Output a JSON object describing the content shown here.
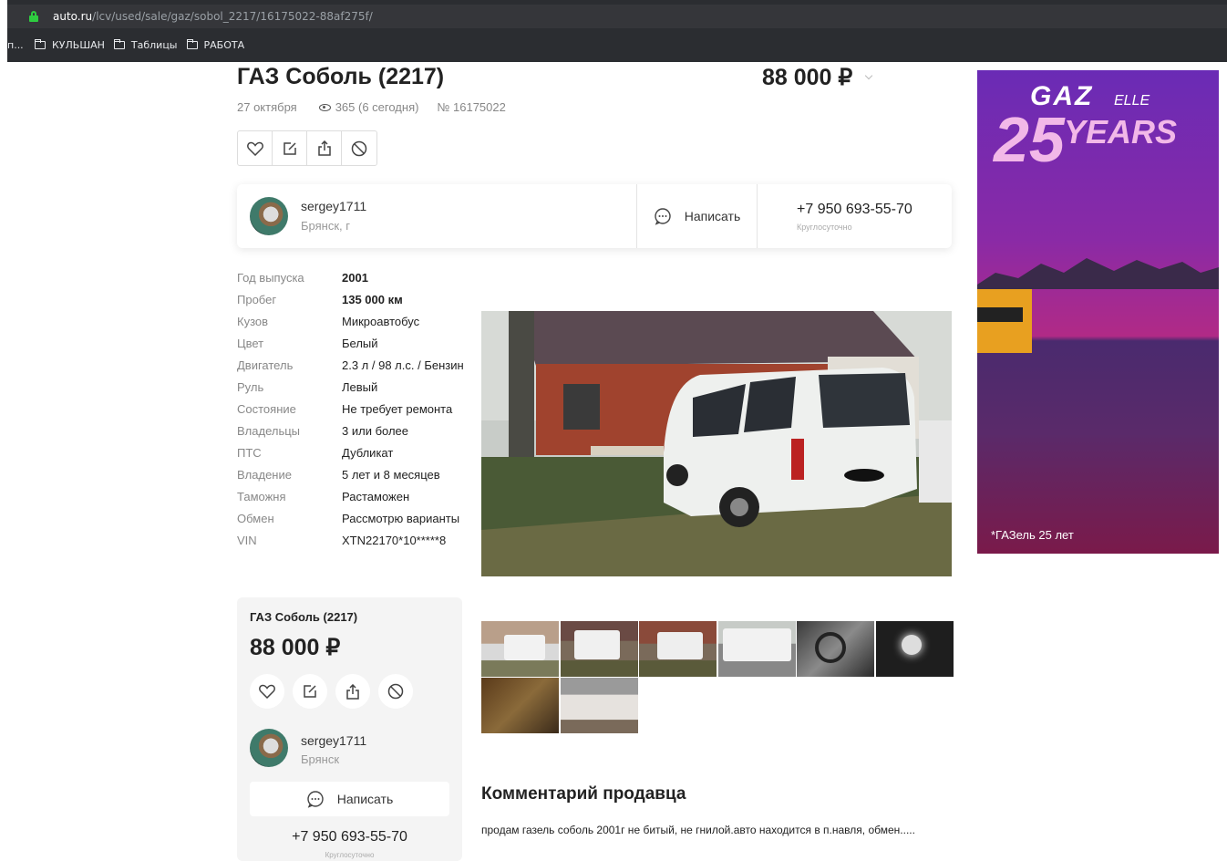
{
  "browser": {
    "url_host": "auto.ru",
    "url_path": "/lcv/used/sale/gaz/sobol_2217/16175022-88af275f/",
    "bookmark_cut": "п...",
    "bookmarks": [
      "КУЛЬШАН",
      "Таблицы",
      "РАБОТА"
    ]
  },
  "listing": {
    "title": "ГАЗ Соболь (2217)",
    "price": "88 000 ₽",
    "date": "27 октября",
    "views": "365 (6 сегодня)",
    "number": "№ 16175022"
  },
  "seller": {
    "name": "sergey1711",
    "city": "Брянск, г",
    "city_short": "Брянск",
    "write_label": "Написать",
    "phone": "+7 950 693-55-70",
    "phone_note": "Круглосуточно"
  },
  "specs": [
    {
      "k": "Год выпуска",
      "v": "2001",
      "bold": true
    },
    {
      "k": "Пробег",
      "v": "135 000 км",
      "bold": true
    },
    {
      "k": "Кузов",
      "v": "Микроавтобус"
    },
    {
      "k": "Цвет",
      "v": "Белый"
    },
    {
      "k": "Двигатель",
      "v": "2.3 л / 98 л.с. / Бензин"
    },
    {
      "k": "Руль",
      "v": "Левый"
    },
    {
      "k": "Состояние",
      "v": "Не требует ремонта"
    },
    {
      "k": "Владельцы",
      "v": "3 или более"
    },
    {
      "k": "ПТС",
      "v": "Дубликат"
    },
    {
      "k": "Владение",
      "v": "5 лет и 8 месяцев"
    },
    {
      "k": "Таможня",
      "v": "Растаможен"
    },
    {
      "k": "Обмен",
      "v": "Рассмотрю варианты"
    },
    {
      "k": "VIN",
      "v": "XTN22170*10*****8"
    }
  ],
  "comment": {
    "heading": "Комментарий продавца",
    "text": "продам газель соболь 2001г не битый, не гнилой.авто находится в п.навля, обмен....."
  },
  "ad": {
    "brand": "GAZelle",
    "years": "25YEARS",
    "caption": "*ГАЗель 25 лет"
  }
}
